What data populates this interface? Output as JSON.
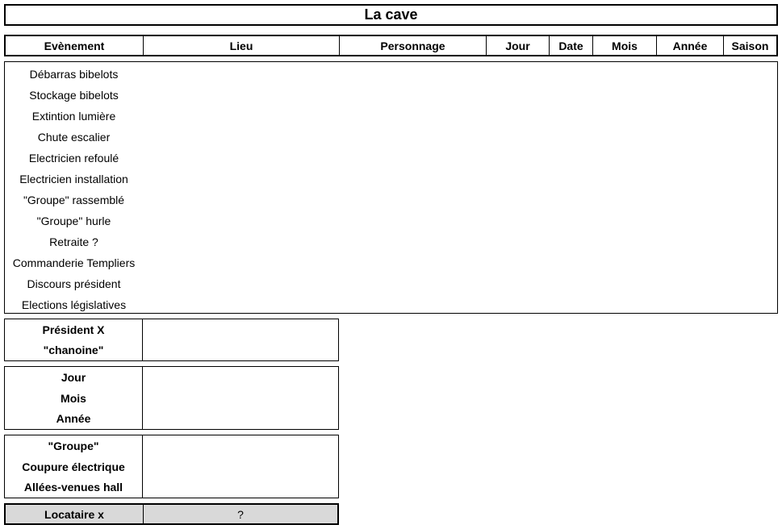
{
  "title": "La cave",
  "headers": [
    "Evènement",
    "Lieu",
    "Personnage",
    "Jour",
    "Date",
    "Mois",
    "Année",
    "Saison"
  ],
  "events": [
    "Débarras bibelots",
    "Stockage bibelots",
    "Extintion lumière",
    "Chute escalier",
    "Electricien refoulé",
    "Electricien installation",
    "\"Groupe\" rassemblé",
    "\"Groupe\" hurle",
    "Retraite ?",
    "Commanderie Templiers",
    "Discours président",
    "Elections législatives"
  ],
  "group1": [
    "Président X",
    "\"chanoine\""
  ],
  "group2": [
    "Jour",
    "Mois",
    "Année"
  ],
  "group3": [
    "\"Groupe\"",
    "Coupure électrique",
    "Allées-venues hall"
  ],
  "group4": {
    "label": "Locataire x",
    "value": "?"
  },
  "colors": {
    "highlight_row": "#d9d9d9"
  }
}
